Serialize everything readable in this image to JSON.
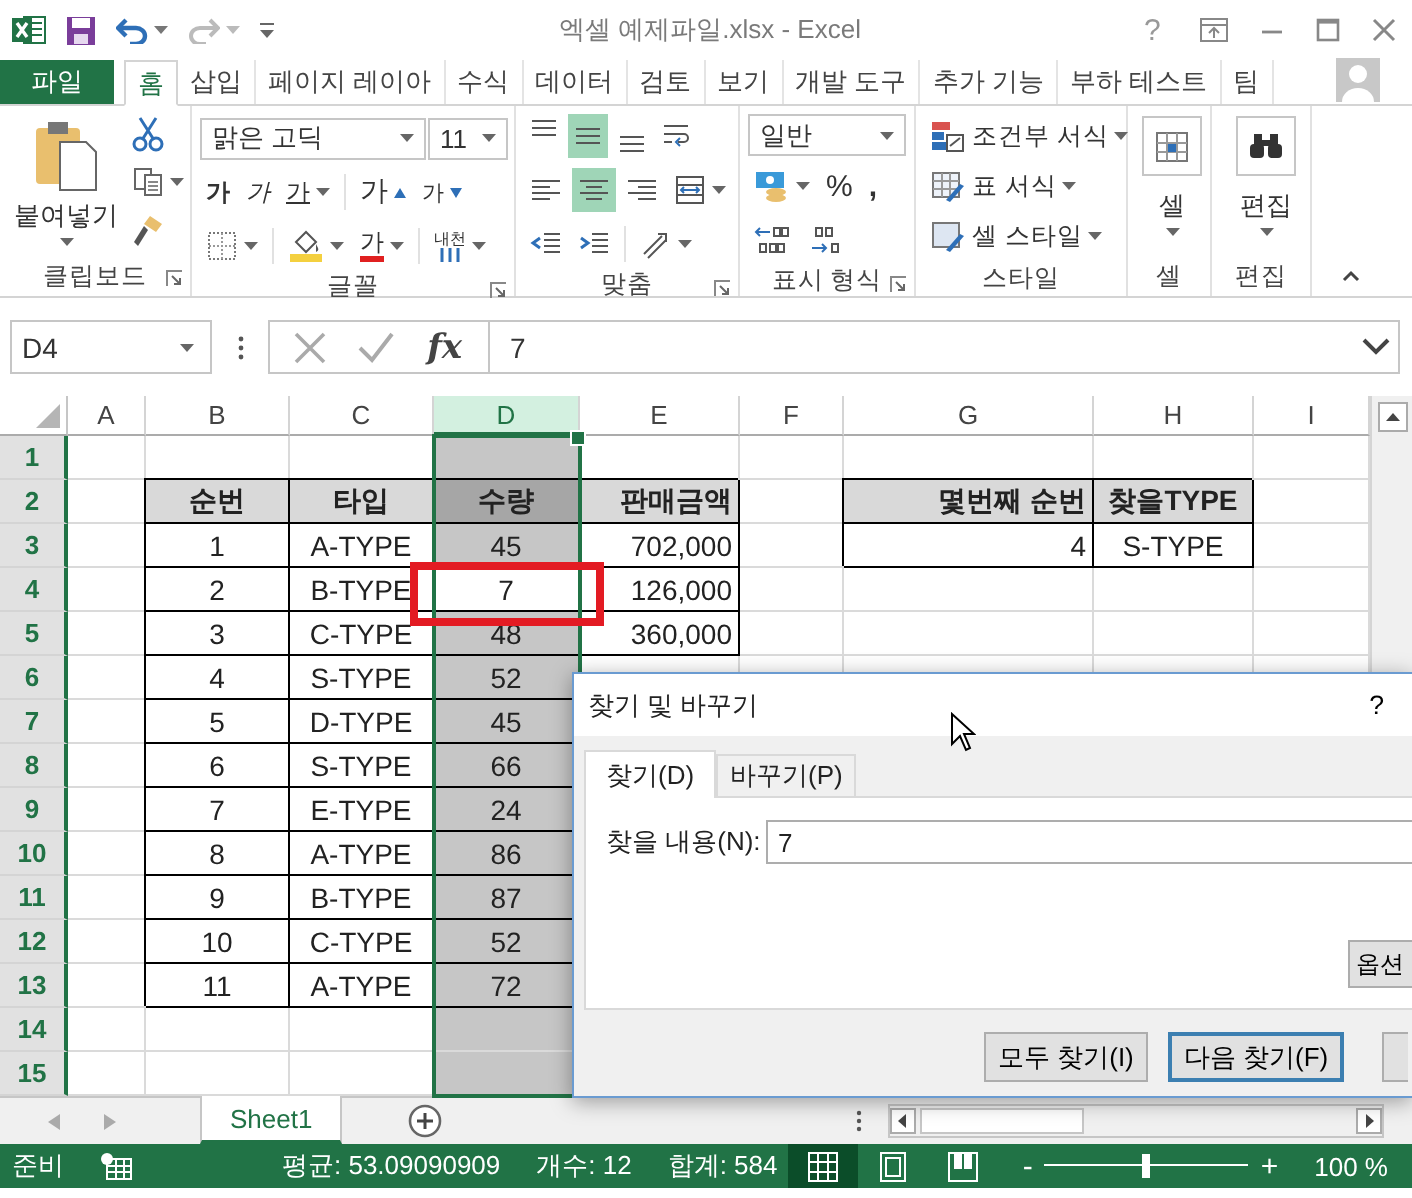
{
  "window": {
    "title": "엑셀 예제파일.xlsx - Excel",
    "help": "?"
  },
  "ribbon_tabs": [
    {
      "label": "파일",
      "kind": "file",
      "selected": false
    },
    {
      "label": "홈",
      "kind": "tab",
      "selected": true
    },
    {
      "label": "삽입",
      "kind": "tab",
      "selected": false
    },
    {
      "label": "페이지 레이아",
      "kind": "tab",
      "selected": false
    },
    {
      "label": "수식",
      "kind": "tab",
      "selected": false
    },
    {
      "label": "데이터",
      "kind": "tab",
      "selected": false
    },
    {
      "label": "검토",
      "kind": "tab",
      "selected": false
    },
    {
      "label": "보기",
      "kind": "tab",
      "selected": false
    },
    {
      "label": "개발 도구",
      "kind": "tab",
      "selected": false
    },
    {
      "label": "추가 기능",
      "kind": "tab",
      "selected": false
    },
    {
      "label": "부하 테스트",
      "kind": "tab",
      "selected": false
    },
    {
      "label": "팀",
      "kind": "tab",
      "selected": false
    }
  ],
  "ribbon": {
    "clipboard": {
      "paste": "붙여넣기",
      "label": "클립보드",
      "launcher": true
    },
    "font": {
      "font_name": "맑은 고딕",
      "font_size": "11",
      "bold": "가",
      "italic": "가",
      "underline": "가",
      "grow": "가",
      "shrink": "가",
      "font_color": "가",
      "phonetic": "내천",
      "label": "글꼴",
      "launcher": true
    },
    "alignment": {
      "vertical": [
        {
          "selected": false
        },
        {
          "selected": true
        },
        {
          "selected": false
        }
      ],
      "horizontal": [
        {
          "selected": false
        },
        {
          "selected": true
        },
        {
          "selected": false
        }
      ],
      "label": "맞춤",
      "launcher": true
    },
    "number": {
      "format": "일반",
      "percent": "%",
      "comma": ",",
      "label": "표시 형식",
      "launcher": true
    },
    "styles": {
      "items": [
        "조건부 서식",
        "표 서식",
        "셀 스타일"
      ],
      "label": "스타일",
      "launcher": false
    },
    "cells": {
      "button_label": "셀",
      "label": "셀"
    },
    "editing": {
      "button_label": "편집",
      "label": "편집"
    }
  },
  "formula_bar": {
    "name_box": "D4",
    "function_label": "fx",
    "value": "7"
  },
  "sheet": {
    "columns": [
      {
        "label": "A",
        "selected": false
      },
      {
        "label": "B",
        "selected": false
      },
      {
        "label": "C",
        "selected": false
      },
      {
        "label": "D",
        "selected": true
      },
      {
        "label": "E",
        "selected": false
      },
      {
        "label": "F",
        "selected": false
      },
      {
        "label": "G",
        "selected": false
      },
      {
        "label": "H",
        "selected": false
      },
      {
        "label": "I",
        "selected": false
      }
    ],
    "rows": [
      {
        "label": "1",
        "kind": "data"
      },
      {
        "label": "2",
        "kind": "header",
        "b": "순번",
        "c": "타입",
        "d": "수량",
        "e": "판매금액",
        "g": "몇번째 순번",
        "h": "찾을TYPE"
      },
      {
        "label": "3",
        "kind": "data",
        "b": "1",
        "c": "A-TYPE",
        "d": "45",
        "e": "702,000",
        "g": "4",
        "h": "S-TYPE"
      },
      {
        "label": "4",
        "kind": "data",
        "b": "2",
        "c": "B-TYPE",
        "d": {
          "text": "7",
          "active": true
        },
        "e": "126,000"
      },
      {
        "label": "5",
        "kind": "data",
        "b": "3",
        "c": "C-TYPE",
        "d": "48",
        "e": "360,000"
      },
      {
        "label": "6",
        "kind": "data",
        "b": "4",
        "c": "S-TYPE",
        "d": "52"
      },
      {
        "label": "7",
        "kind": "data",
        "b": "5",
        "c": "D-TYPE",
        "d": "45"
      },
      {
        "label": "8",
        "kind": "data",
        "b": "6",
        "c": "S-TYPE",
        "d": "66"
      },
      {
        "label": "9",
        "kind": "data",
        "b": "7",
        "c": "E-TYPE",
        "d": "24"
      },
      {
        "label": "10",
        "kind": "data",
        "b": "8",
        "c": "A-TYPE",
        "d": "86"
      },
      {
        "label": "11",
        "kind": "data",
        "b": "9",
        "c": "B-TYPE",
        "d": "87"
      },
      {
        "label": "12",
        "kind": "data",
        "b": "10",
        "c": "C-TYPE",
        "d": "52"
      },
      {
        "label": "13",
        "kind": "data",
        "b": "11",
        "c": "A-TYPE",
        "d": "72"
      },
      {
        "label": "14",
        "kind": "data"
      },
      {
        "label": "15",
        "kind": "data"
      }
    ]
  },
  "sheet_tabs": [
    {
      "label": "Sheet1",
      "selected": true
    }
  ],
  "dialog": {
    "title": "찾기 및 바꾸기",
    "help": "?",
    "tabs": [
      {
        "label": "찾기(D)",
        "selected": true
      },
      {
        "label": "바꾸기(P)",
        "selected": false
      }
    ],
    "find_label": "찾을 내용(N):",
    "find_value": "7",
    "options_button": "옵션",
    "buttons": [
      {
        "label": "모두 찾기(I)",
        "default": false
      },
      {
        "label": "다음 찾기(F)",
        "default": true
      },
      {
        "default": false
      }
    ]
  },
  "status_bar": {
    "mode": "준비",
    "average": "평균: 53.09090909",
    "count": "개수: 12",
    "sum": "합계: 584",
    "views": [
      {
        "selected": true
      },
      {
        "selected": false
      },
      {
        "selected": false
      }
    ],
    "zoom": {
      "minus": "-",
      "plus": "+",
      "level": 0.5,
      "reading": "100 %"
    }
  }
}
